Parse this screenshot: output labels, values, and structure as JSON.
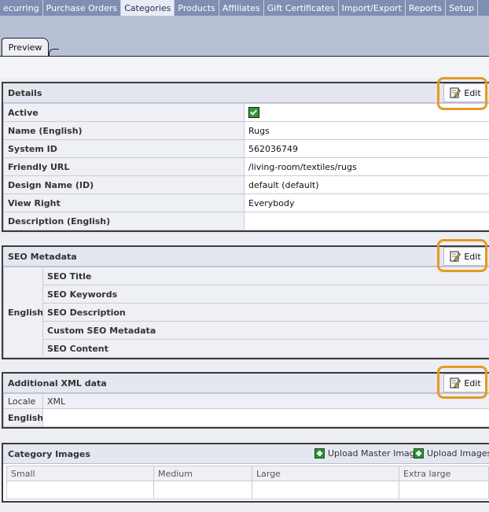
{
  "nav": {
    "tabs": [
      "ecurring",
      "Purchase Orders",
      "Categories",
      "Products",
      "Affiliates",
      "Gift Certificates",
      "Import/Export",
      "Reports",
      "Setup"
    ],
    "active_index": 2
  },
  "preview_tab": {
    "label": "Preview"
  },
  "details": {
    "title": "Details",
    "edit_label": "Edit",
    "rows": [
      {
        "label": "Active",
        "value": ""
      },
      {
        "label": "Name (English)",
        "value": "Rugs"
      },
      {
        "label": "System ID",
        "value": "562036749"
      },
      {
        "label": "Friendly URL",
        "value": "/living-room/textiles/rugs"
      },
      {
        "label": "Design Name (ID)",
        "value": "default (default)"
      },
      {
        "label": "View Right",
        "value": "Everybody"
      },
      {
        "label": "Description (English)",
        "value": ""
      }
    ]
  },
  "seo": {
    "title": "SEO Metadata",
    "edit_label": "Edit",
    "locale": "English",
    "fields": [
      "SEO Title",
      "SEO Keywords",
      "SEO Description",
      "Custom SEO Metadata",
      "SEO Content"
    ]
  },
  "xml": {
    "title": "Additional XML data",
    "edit_label": "Edit",
    "columns": [
      "Locale",
      "XML"
    ],
    "rows": [
      {
        "locale": "English",
        "xml": ""
      }
    ]
  },
  "images": {
    "title": "Category Images",
    "upload_master_label": "Upload Master Image",
    "upload_images_label": "Upload Images p",
    "columns": [
      "Small",
      "Medium",
      "Large",
      "Extra large"
    ]
  },
  "colors": {
    "nav_bg": "#7f8fb3",
    "highlight_ring": "#e69a22",
    "active_check": "#2f9a3a"
  }
}
